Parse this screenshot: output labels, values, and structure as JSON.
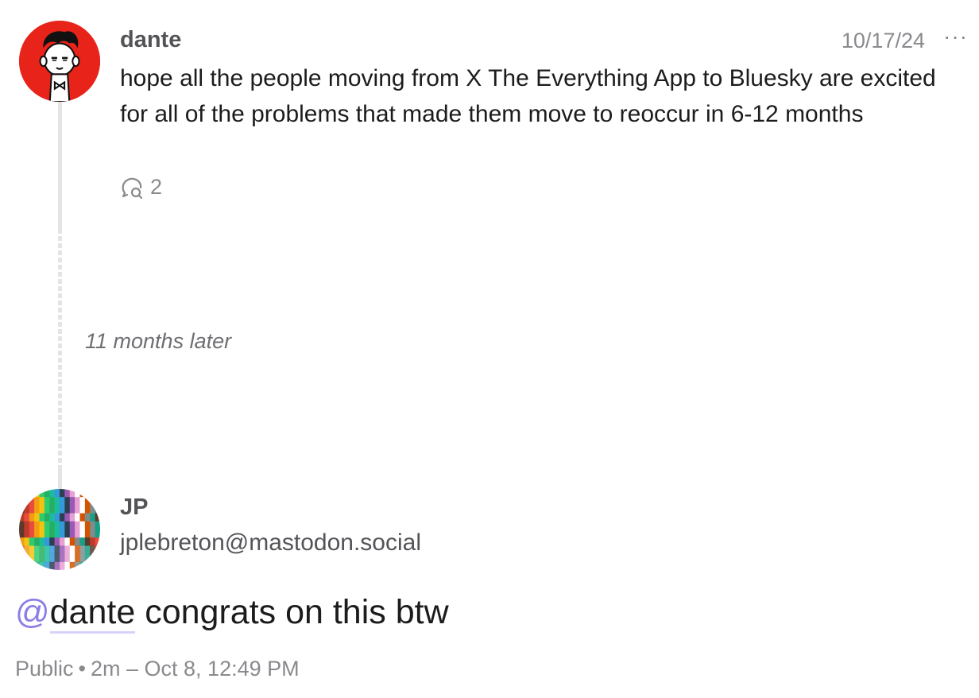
{
  "original_post": {
    "author": "dante",
    "timestamp": "10/17/24",
    "more_label": "···",
    "text": "hope all the people moving from X The Everything App to Bluesky are excited for all of the problems that made them move to reoccur in 6-12 months",
    "reply_count": "2",
    "avatar_color": "#e8231a"
  },
  "thread_gap": {
    "label": "11 months later"
  },
  "reply": {
    "author_name": "JP",
    "author_handle": "jplebreton@mastodon.social",
    "mention_at": "@",
    "mention_name": "dante",
    "text": " congrats on this btw",
    "visibility": "Public",
    "separator": "•",
    "relative_time": "2m – Oct 8, 12:49 PM"
  },
  "colors": {
    "mention_accent": "#8b7ee6",
    "muted_text": "#8a8a8e"
  }
}
